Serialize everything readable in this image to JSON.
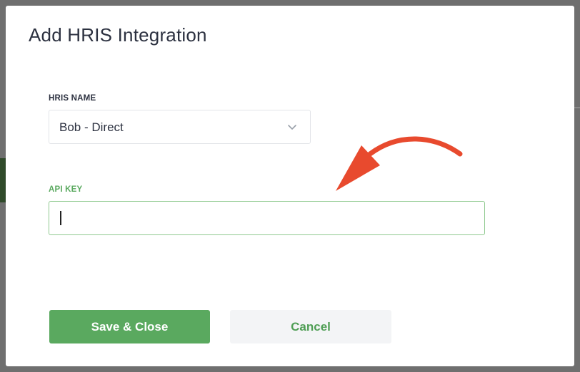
{
  "modal": {
    "title": "Add HRIS Integration"
  },
  "hris_name": {
    "label": "HRIS NAME",
    "selected_value": "Bob - Direct",
    "icon": "chevron-down-icon"
  },
  "api_key": {
    "label": "API KEY",
    "value": "",
    "placeholder": ""
  },
  "actions": {
    "save_label": "Save & Close",
    "cancel_label": "Cancel"
  },
  "colors": {
    "primary_green": "#5aa95f",
    "focus_border": "#8fc98f",
    "title_text": "#2c3140",
    "annotation_arrow": "#e84a2e",
    "cancel_bg": "#f3f4f6"
  }
}
